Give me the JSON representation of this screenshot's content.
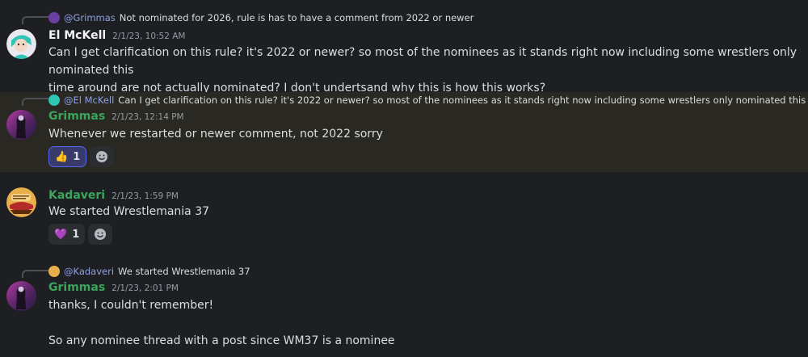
{
  "messages": [
    {
      "reply": {
        "mention": "@Grimmas",
        "snippet": "Not nominated for 2026, rule is has to have a comment from 2022 or newer"
      },
      "author": "El McKell",
      "author_color": "#f2f3f5",
      "timestamp": "2/1/23, 10:52 AM",
      "lines": [
        "Can I get clarification on this rule? it's 2022 or newer? so most of the nominees as it stands right now including some wrestlers only nominated this",
        "time around are not actually nominated? I don't undertsand why this is how this works?"
      ]
    },
    {
      "reply": {
        "mention": "@El McKell",
        "snippet": "Can I get clarification on this rule? it's 2022 or newer? so most of the nominees as it stands right now including some wrestlers only nominated this time ..."
      },
      "author": "Grimmas",
      "author_color": "#3ba55c",
      "timestamp": "2/1/23, 12:14 PM",
      "lines": [
        "Whenever we restarted or newer comment, not 2022 sorry"
      ],
      "reaction": {
        "emoji": "👍",
        "count": "1"
      }
    },
    {
      "author": "Kadaveri",
      "author_color": "#3ba55c",
      "timestamp": "2/1/23, 1:59 PM",
      "lines": [
        "We started Wrestlemania 37"
      ],
      "reaction": {
        "emoji": "💜",
        "count": "1"
      }
    },
    {
      "reply": {
        "mention": "@Kadaveri",
        "snippet": "We started Wrestlemania 37"
      },
      "author": "Grimmas",
      "author_color": "#3ba55c",
      "timestamp": "2/1/23, 2:01 PM",
      "lines": [
        "thanks, I couldn't remember!",
        "",
        "So any nominee thread with a post since WM37 is a nominee"
      ]
    }
  ],
  "icons": {
    "add_reaction": "smiley-add-icon",
    "avatar_el_mckell": "teal-character-avatar",
    "avatar_grimmas": "pink-purple-figure-avatar",
    "avatar_kadaveri": "orange-burger-avatar"
  }
}
